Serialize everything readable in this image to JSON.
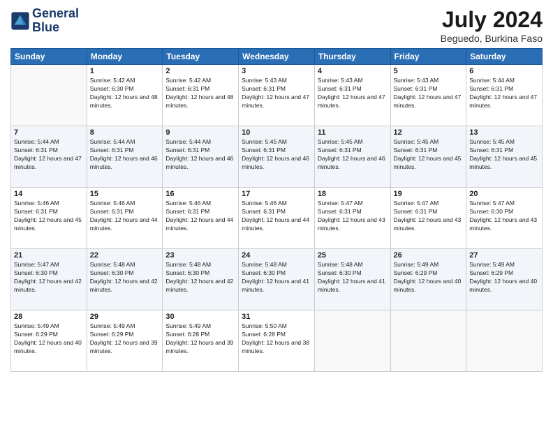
{
  "header": {
    "logo_line1": "General",
    "logo_line2": "Blue",
    "month": "July 2024",
    "location": "Beguedo, Burkina Faso"
  },
  "days_of_week": [
    "Sunday",
    "Monday",
    "Tuesday",
    "Wednesday",
    "Thursday",
    "Friday",
    "Saturday"
  ],
  "weeks": [
    [
      {
        "day": "",
        "sunrise": "",
        "sunset": "",
        "daylight": ""
      },
      {
        "day": "1",
        "sunrise": "Sunrise: 5:42 AM",
        "sunset": "Sunset: 6:30 PM",
        "daylight": "Daylight: 12 hours and 48 minutes."
      },
      {
        "day": "2",
        "sunrise": "Sunrise: 5:42 AM",
        "sunset": "Sunset: 6:31 PM",
        "daylight": "Daylight: 12 hours and 48 minutes."
      },
      {
        "day": "3",
        "sunrise": "Sunrise: 5:43 AM",
        "sunset": "Sunset: 6:31 PM",
        "daylight": "Daylight: 12 hours and 47 minutes."
      },
      {
        "day": "4",
        "sunrise": "Sunrise: 5:43 AM",
        "sunset": "Sunset: 6:31 PM",
        "daylight": "Daylight: 12 hours and 47 minutes."
      },
      {
        "day": "5",
        "sunrise": "Sunrise: 5:43 AM",
        "sunset": "Sunset: 6:31 PM",
        "daylight": "Daylight: 12 hours and 47 minutes."
      },
      {
        "day": "6",
        "sunrise": "Sunrise: 5:44 AM",
        "sunset": "Sunset: 6:31 PM",
        "daylight": "Daylight: 12 hours and 47 minutes."
      }
    ],
    [
      {
        "day": "7",
        "sunrise": "Sunrise: 5:44 AM",
        "sunset": "Sunset: 6:31 PM",
        "daylight": "Daylight: 12 hours and 47 minutes."
      },
      {
        "day": "8",
        "sunrise": "Sunrise: 5:44 AM",
        "sunset": "Sunset: 6:31 PM",
        "daylight": "Daylight: 12 hours and 46 minutes."
      },
      {
        "day": "9",
        "sunrise": "Sunrise: 5:44 AM",
        "sunset": "Sunset: 6:31 PM",
        "daylight": "Daylight: 12 hours and 46 minutes."
      },
      {
        "day": "10",
        "sunrise": "Sunrise: 5:45 AM",
        "sunset": "Sunset: 6:31 PM",
        "daylight": "Daylight: 12 hours and 46 minutes."
      },
      {
        "day": "11",
        "sunrise": "Sunrise: 5:45 AM",
        "sunset": "Sunset: 6:31 PM",
        "daylight": "Daylight: 12 hours and 46 minutes."
      },
      {
        "day": "12",
        "sunrise": "Sunrise: 5:45 AM",
        "sunset": "Sunset: 6:31 PM",
        "daylight": "Daylight: 12 hours and 45 minutes."
      },
      {
        "day": "13",
        "sunrise": "Sunrise: 5:45 AM",
        "sunset": "Sunset: 6:31 PM",
        "daylight": "Daylight: 12 hours and 45 minutes."
      }
    ],
    [
      {
        "day": "14",
        "sunrise": "Sunrise: 5:46 AM",
        "sunset": "Sunset: 6:31 PM",
        "daylight": "Daylight: 12 hours and 45 minutes."
      },
      {
        "day": "15",
        "sunrise": "Sunrise: 5:46 AM",
        "sunset": "Sunset: 6:31 PM",
        "daylight": "Daylight: 12 hours and 44 minutes."
      },
      {
        "day": "16",
        "sunrise": "Sunrise: 5:46 AM",
        "sunset": "Sunset: 6:31 PM",
        "daylight": "Daylight: 12 hours and 44 minutes."
      },
      {
        "day": "17",
        "sunrise": "Sunrise: 5:46 AM",
        "sunset": "Sunset: 6:31 PM",
        "daylight": "Daylight: 12 hours and 44 minutes."
      },
      {
        "day": "18",
        "sunrise": "Sunrise: 5:47 AM",
        "sunset": "Sunset: 6:31 PM",
        "daylight": "Daylight: 12 hours and 43 minutes."
      },
      {
        "day": "19",
        "sunrise": "Sunrise: 5:47 AM",
        "sunset": "Sunset: 6:31 PM",
        "daylight": "Daylight: 12 hours and 43 minutes."
      },
      {
        "day": "20",
        "sunrise": "Sunrise: 5:47 AM",
        "sunset": "Sunset: 6:30 PM",
        "daylight": "Daylight: 12 hours and 43 minutes."
      }
    ],
    [
      {
        "day": "21",
        "sunrise": "Sunrise: 5:47 AM",
        "sunset": "Sunset: 6:30 PM",
        "daylight": "Daylight: 12 hours and 42 minutes."
      },
      {
        "day": "22",
        "sunrise": "Sunrise: 5:48 AM",
        "sunset": "Sunset: 6:30 PM",
        "daylight": "Daylight: 12 hours and 42 minutes."
      },
      {
        "day": "23",
        "sunrise": "Sunrise: 5:48 AM",
        "sunset": "Sunset: 6:30 PM",
        "daylight": "Daylight: 12 hours and 42 minutes."
      },
      {
        "day": "24",
        "sunrise": "Sunrise: 5:48 AM",
        "sunset": "Sunset: 6:30 PM",
        "daylight": "Daylight: 12 hours and 41 minutes."
      },
      {
        "day": "25",
        "sunrise": "Sunrise: 5:48 AM",
        "sunset": "Sunset: 6:30 PM",
        "daylight": "Daylight: 12 hours and 41 minutes."
      },
      {
        "day": "26",
        "sunrise": "Sunrise: 5:49 AM",
        "sunset": "Sunset: 6:29 PM",
        "daylight": "Daylight: 12 hours and 40 minutes."
      },
      {
        "day": "27",
        "sunrise": "Sunrise: 5:49 AM",
        "sunset": "Sunset: 6:29 PM",
        "daylight": "Daylight: 12 hours and 40 minutes."
      }
    ],
    [
      {
        "day": "28",
        "sunrise": "Sunrise: 5:49 AM",
        "sunset": "Sunset: 6:29 PM",
        "daylight": "Daylight: 12 hours and 40 minutes."
      },
      {
        "day": "29",
        "sunrise": "Sunrise: 5:49 AM",
        "sunset": "Sunset: 6:29 PM",
        "daylight": "Daylight: 12 hours and 39 minutes."
      },
      {
        "day": "30",
        "sunrise": "Sunrise: 5:49 AM",
        "sunset": "Sunset: 6:28 PM",
        "daylight": "Daylight: 12 hours and 39 minutes."
      },
      {
        "day": "31",
        "sunrise": "Sunrise: 5:50 AM",
        "sunset": "Sunset: 6:28 PM",
        "daylight": "Daylight: 12 hours and 38 minutes."
      },
      {
        "day": "",
        "sunrise": "",
        "sunset": "",
        "daylight": ""
      },
      {
        "day": "",
        "sunrise": "",
        "sunset": "",
        "daylight": ""
      },
      {
        "day": "",
        "sunrise": "",
        "sunset": "",
        "daylight": ""
      }
    ]
  ]
}
